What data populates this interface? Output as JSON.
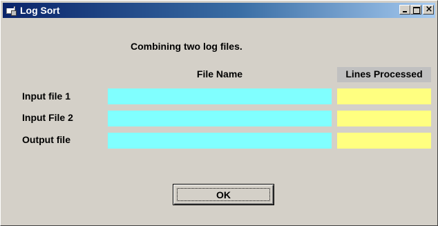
{
  "window": {
    "title": "Log Sort",
    "controls": {
      "minimize": "_",
      "maximize": "□",
      "close": "×"
    }
  },
  "form": {
    "heading": "Combining two log files.",
    "columns": {
      "file_name": "File Name",
      "lines_processed": "Lines Processed"
    },
    "rows": [
      {
        "label": "Input file 1",
        "file_value": "",
        "lines_value": ""
      },
      {
        "label": "Input File 2",
        "file_value": "",
        "lines_value": ""
      },
      {
        "label": "Output file",
        "file_value": "",
        "lines_value": ""
      }
    ],
    "ok_label": "OK"
  },
  "colors": {
    "file_field": "#80ffff",
    "lines_field": "#ffff80",
    "face": "#d4d0c8",
    "titlebar": "#0a246a"
  },
  "icons": {
    "app": "app-window-icon"
  }
}
